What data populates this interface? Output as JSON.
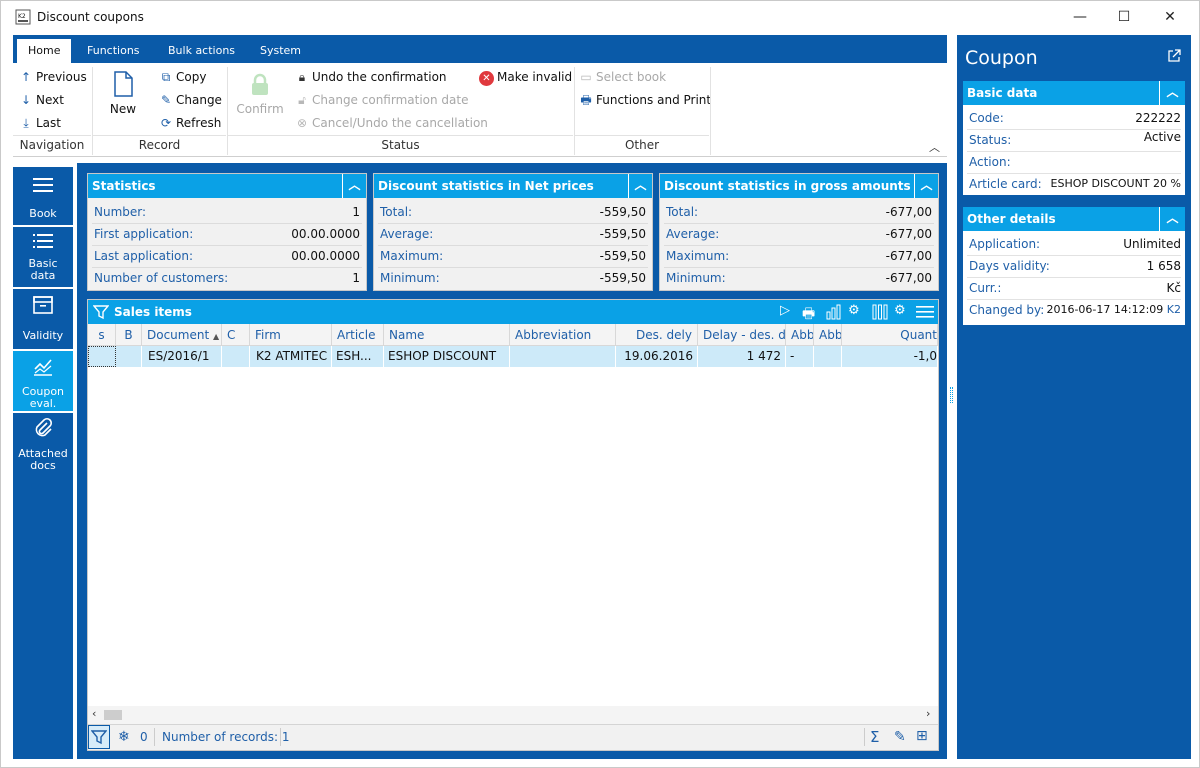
{
  "window": {
    "title": "Discount coupons",
    "minimize": "—",
    "maximize": "☐",
    "close": "✕"
  },
  "ribbon": {
    "tabs": [
      "Home",
      "Functions",
      "Bulk actions",
      "System"
    ],
    "navigation": {
      "label": "Navigation",
      "previous": "Previous",
      "next": "Next",
      "last": "Last"
    },
    "record": {
      "label": "Record",
      "new": "New",
      "copy": "Copy",
      "change": "Change",
      "refresh": "Refresh"
    },
    "status": {
      "label": "Status",
      "confirm": "Confirm",
      "undo_confirmation": "Undo the confirmation",
      "change_confirmation_date": "Change confirmation date",
      "cancel_undo": "Cancel/Undo the cancellation",
      "make_invalid": "Make invalid"
    },
    "other": {
      "label": "Other",
      "select_book": "Select book",
      "functions_print": "Functions and Print"
    }
  },
  "leftnav": [
    {
      "label": "Book",
      "icon": "hamburger-icon"
    },
    {
      "label": "Basic data",
      "icon": "list-icon"
    },
    {
      "label": "Validity",
      "icon": "archive-icon"
    },
    {
      "label": "Coupon eval.",
      "icon": "chart-icon",
      "active": true
    },
    {
      "label": "Attached docs",
      "icon": "paperclip-icon"
    }
  ],
  "stats": {
    "title": "Statistics",
    "rows": [
      {
        "label": "Number:",
        "value": "1"
      },
      {
        "label": "First application:",
        "value": "00.00.0000"
      },
      {
        "label": "Last application:",
        "value": "00.00.0000"
      },
      {
        "label": "Number of customers:",
        "value": "1"
      }
    ]
  },
  "net": {
    "title": "Discount statistics in Net prices",
    "rows": [
      {
        "label": "Total:",
        "value": "-559,50"
      },
      {
        "label": "Average:",
        "value": "-559,50"
      },
      {
        "label": "Maximum:",
        "value": "-559,50"
      },
      {
        "label": "Minimum:",
        "value": "-559,50"
      }
    ]
  },
  "gross": {
    "title": "Discount statistics in gross amounts",
    "rows": [
      {
        "label": "Total:",
        "value": "-677,00"
      },
      {
        "label": "Average:",
        "value": "-677,00"
      },
      {
        "label": "Maximum:",
        "value": "-677,00"
      },
      {
        "label": "Minimum:",
        "value": "-677,00"
      }
    ]
  },
  "sales": {
    "title": "Sales items",
    "columns": [
      "s",
      "B",
      "Document",
      "C",
      "Firm",
      "Article",
      "Name",
      "Abbreviation",
      "Des. dely",
      "Delay - des. d.",
      "Abb",
      "Abb",
      "Quant"
    ],
    "row": [
      "",
      "",
      "ES/2016/1",
      "",
      "K2 ATMITEC",
      "ESH...",
      "ESHOP DISCOUNT",
      "",
      "19.06.2016",
      "1 472",
      "-",
      "",
      "-1,0"
    ],
    "footer": {
      "count": "0",
      "records": "Number of records: 1"
    }
  },
  "coupon": {
    "title": "Coupon",
    "basic": {
      "title": "Basic data",
      "rows": [
        {
          "label": "Code:",
          "value": "222222"
        },
        {
          "label": "Status:",
          "value": "Active"
        },
        {
          "label": "Action:",
          "value": ""
        },
        {
          "label": "Article card:",
          "value": "ESHOP DISCOUNT 20 %"
        }
      ]
    },
    "other": {
      "title": "Other details",
      "rows": [
        {
          "label": "Application:",
          "value": "Unlimited"
        },
        {
          "label": "Days validity:",
          "value": "1 658"
        },
        {
          "label": "Curr.:",
          "value": "Kč"
        },
        {
          "label": "Changed by:",
          "value": "2016-06-17 14:12:09",
          "extra": "K2"
        }
      ]
    }
  },
  "colors": {
    "brand": "#0a5aa8",
    "accent": "#0aa1e6",
    "label": "#1f5fa8",
    "danger": "#e0393e"
  }
}
